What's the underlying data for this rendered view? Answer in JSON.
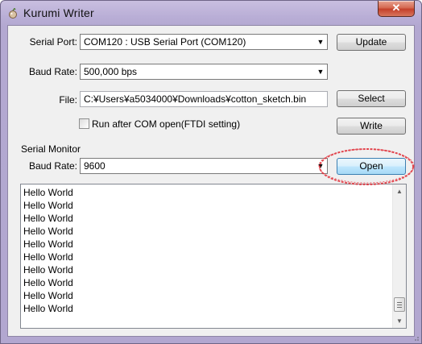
{
  "window": {
    "title": "Kurumi Writer",
    "close_label": "✕"
  },
  "serial_port": {
    "label": "Serial Port:",
    "value": "COM120 : USB Serial Port (COM120)"
  },
  "baud_rate": {
    "label": "Baud Rate:",
    "value": "500,000 bps"
  },
  "file": {
    "label": "File:",
    "value": "C:¥Users¥a5034000¥Downloads¥cotton_sketch.bin"
  },
  "run_after": {
    "label": "Run after COM open(FTDI setting)",
    "checked": false
  },
  "buttons": {
    "update": "Update",
    "select": "Select",
    "write": "Write",
    "open": "Open"
  },
  "serial_monitor": {
    "group_label": "Serial Monitor",
    "baud_label": "Baud Rate:",
    "baud_value": "9600",
    "lines": [
      "Hello World",
      "Hello World",
      "Hello World",
      "Hello World",
      "Hello World",
      "Hello World",
      "Hello World",
      "Hello World",
      "Hello World",
      "Hello World"
    ]
  },
  "icons": {
    "app": "kurumi-app-icon",
    "dropdown": "chevron-down-icon",
    "scroll_up": "scroll-up-icon",
    "scroll_down": "scroll-down-icon"
  },
  "colors": {
    "highlight": "#e0303a",
    "title_bar": "#b9aed6",
    "client_bg": "#f0f0f0"
  }
}
